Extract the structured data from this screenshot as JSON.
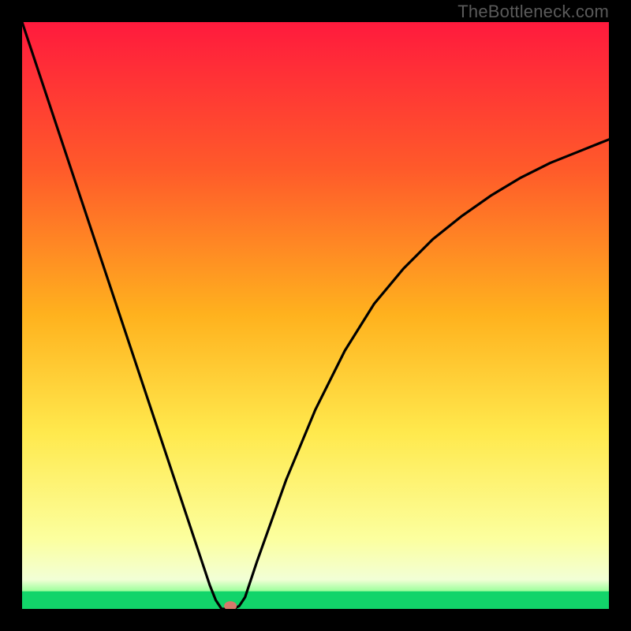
{
  "watermark": "TheBottleneck.com",
  "chart_data": {
    "type": "line",
    "title": "",
    "xlabel": "",
    "ylabel": "",
    "xlim": [
      0,
      100
    ],
    "ylim": [
      0,
      100
    ],
    "grid": false,
    "legend": false,
    "series": [
      {
        "name": "curve",
        "x": [
          0,
          5,
          10,
          15,
          20,
          25,
          28,
          30,
          32,
          33,
          34,
          35,
          36,
          37,
          38,
          40,
          45,
          50,
          55,
          60,
          65,
          70,
          75,
          80,
          85,
          90,
          95,
          100
        ],
        "y": [
          100,
          85,
          70,
          55,
          40,
          25,
          16,
          10,
          4,
          1.5,
          0,
          0,
          0,
          0.5,
          2,
          8,
          22,
          34,
          44,
          52,
          58,
          63,
          67,
          70.5,
          73.5,
          76,
          78,
          80
        ]
      }
    ],
    "green_band_y": [
      0,
      3
    ],
    "marker": {
      "x": 35.5,
      "y": 0.5,
      "color": "#d6786b"
    },
    "gradient_stops": [
      {
        "y": 0,
        "color": "#ff1a3d"
      },
      {
        "y": 25,
        "color": "#ff5a2a"
      },
      {
        "y": 50,
        "color": "#ffb21e"
      },
      {
        "y": 70,
        "color": "#ffe94d"
      },
      {
        "y": 88,
        "color": "#fcff9e"
      },
      {
        "y": 95,
        "color": "#f2ffd6"
      },
      {
        "y": 97,
        "color": "#9aff9a"
      },
      {
        "y": 100,
        "color": "#12d46a"
      }
    ]
  }
}
